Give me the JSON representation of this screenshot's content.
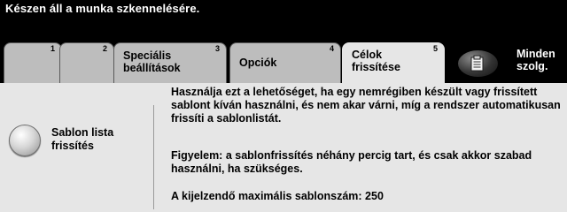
{
  "status_message": "Készen áll a munka szkennelésére.",
  "tabs": [
    {
      "number": "1",
      "label": ""
    },
    {
      "number": "2",
      "label": ""
    },
    {
      "number": "3",
      "label": "Speciális\nbeállítások"
    },
    {
      "number": "4",
      "label": "Opciók"
    },
    {
      "number": "5",
      "label": "Célok\nfrissítése",
      "active": true
    }
  ],
  "all_services": {
    "label": "Minden\nszolg.",
    "icon": "services-icon"
  },
  "refresh_button": {
    "label": "Sablon lista\nfrissítés"
  },
  "info": {
    "paragraph1": "Használja ezt a lehetőséget, ha egy nemrégiben készült vagy frissített sablont kíván használni, és nem akar várni, míg a rendszer automatikusan frissíti a sablonlistát.",
    "paragraph2": "Figyelem: a sablonfrissítés néhány percig tart, és csak akkor szabad használni, ha szükséges.",
    "paragraph3": "A kijelzendő maximális sablonszám: 250"
  }
}
